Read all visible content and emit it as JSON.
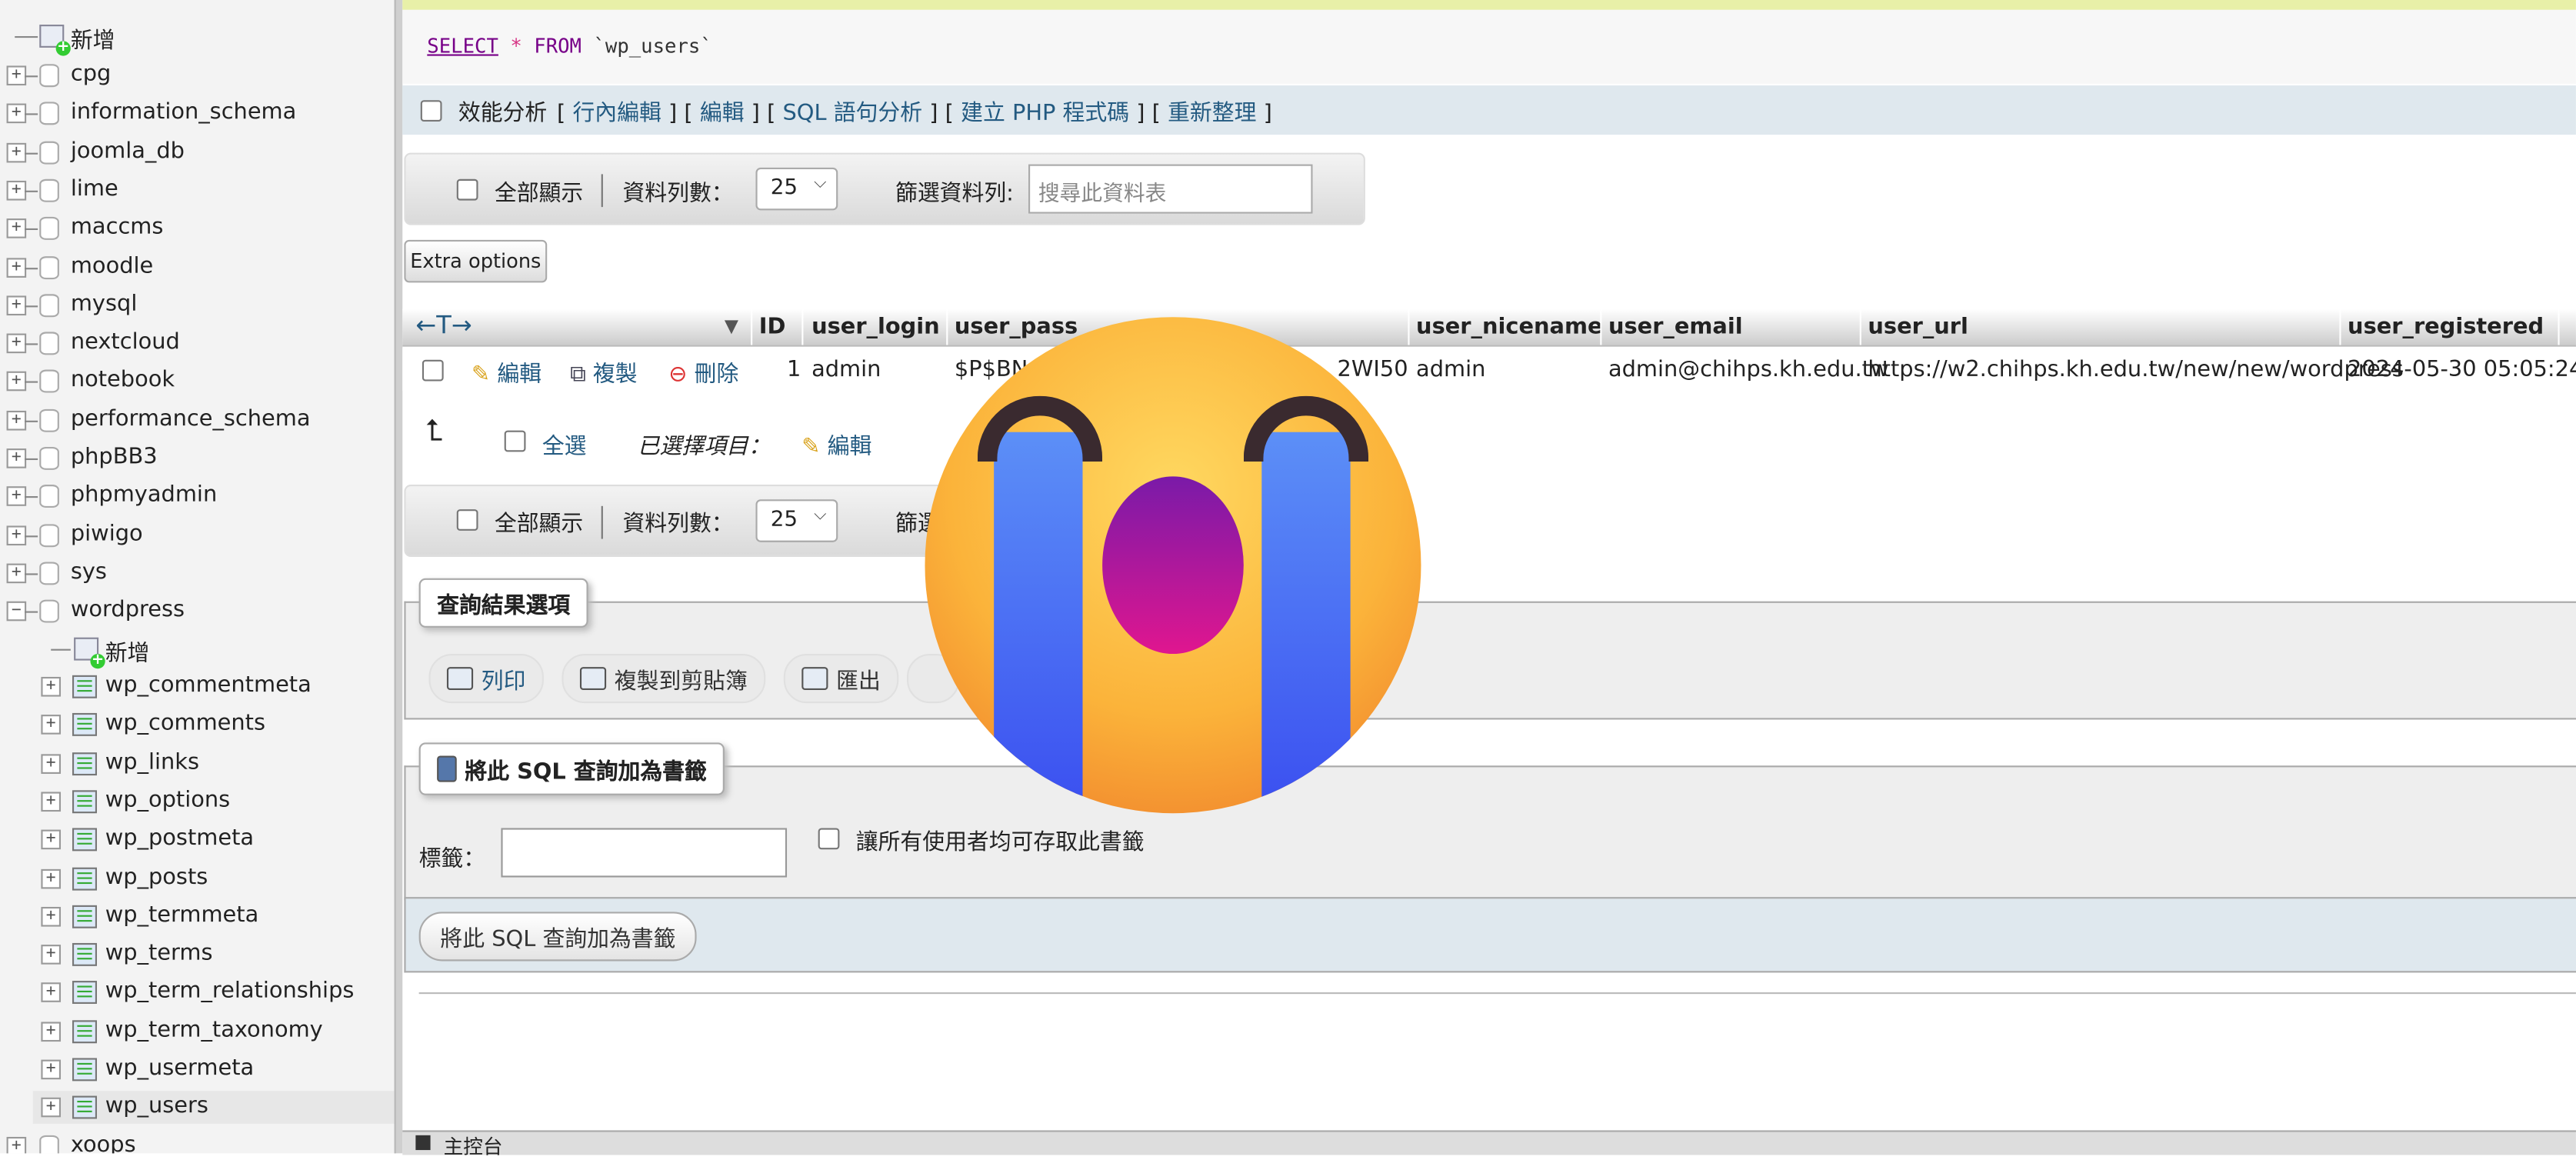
{
  "sidebar": {
    "new_label": "新增",
    "databases": [
      "cpg",
      "information_schema",
      "joomla_db",
      "lime",
      "maccms",
      "moodle",
      "mysql",
      "nextcloud",
      "notebook",
      "performance_schema",
      "phpBB3",
      "phpmyadmin",
      "piwigo",
      "sys",
      "wordpress"
    ],
    "wordpress_new_label": "新增",
    "tables": [
      "wp_commentmeta",
      "wp_comments",
      "wp_links",
      "wp_options",
      "wp_postmeta",
      "wp_posts",
      "wp_termmeta",
      "wp_terms",
      "wp_term_relationships",
      "wp_term_taxonomy",
      "wp_usermeta",
      "wp_users"
    ],
    "last_db": "xoops"
  },
  "query": {
    "select": "SELECT",
    "star": "*",
    "from": "FROM",
    "table": "`wp_users`"
  },
  "profiling": {
    "label": "效能分析",
    "links": [
      "行內編輯",
      "編輯",
      "SQL 語句分析",
      "建立 PHP 程式碼",
      "重新整理"
    ]
  },
  "nav": {
    "show_all": "全部顯示",
    "rows_label": "資料列數：",
    "rows_value": "25",
    "filter_label": "篩選資料列:",
    "filter_placeholder": "搜尋此資料表"
  },
  "extra_options": "Extra options",
  "table": {
    "columns": [
      "ID",
      "user_login",
      "user_pass",
      "user_nicename",
      "user_email",
      "user_url",
      "user_registered"
    ],
    "row_actions": {
      "edit": "編輯",
      "copy": "複製",
      "delete": "刪除"
    },
    "rows": [
      {
        "ID": "1",
        "user_login": "admin",
        "user_pass_start": "$P$BN",
        "user_pass_end": "2WI50",
        "user_nicename": "admin",
        "user_email": "admin@chihps.kh.edu.tw",
        "user_url": "https://w2.chihps.kh.edu.tw/new/new/wordpress",
        "user_registered": "2024-05-30 05:05:24"
      }
    ]
  },
  "bulk": {
    "select_all": "全選",
    "with_selected": "已選擇項目：",
    "edit": "編輯"
  },
  "nav2": {
    "show_all": "全部顯示",
    "rows_label": "資料列數：",
    "rows_value": "25",
    "filter_label": "篩選"
  },
  "query_ops": {
    "legend": "查詢結果選項",
    "print": "列印",
    "copy_clipboard": "複製到剪貼簿",
    "export": "匯出"
  },
  "bookmark": {
    "legend": "將此 SQL 查詢加為書籤",
    "label": "標籤：",
    "share_label": "讓所有使用者均可存取此書籤",
    "submit": "將此 SQL 查詢加為書籤"
  },
  "console_label": "主控台"
}
